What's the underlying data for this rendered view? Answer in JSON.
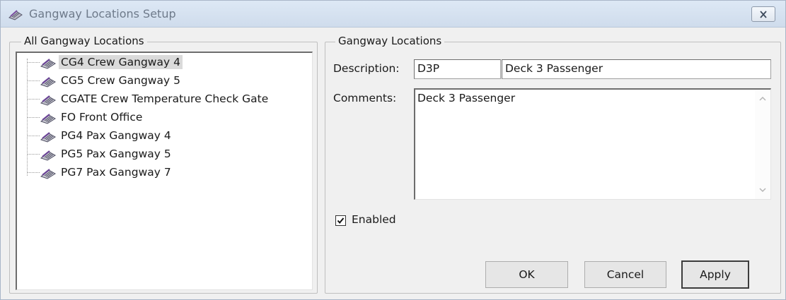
{
  "window": {
    "title": "Gangway Locations Setup",
    "icon": "gangway-icon"
  },
  "left_panel": {
    "group_label": "All Gangway Locations",
    "items": [
      {
        "code": "CG4",
        "name": "Crew Gangway 4",
        "label": "CG4  Crew Gangway 4",
        "selected": true
      },
      {
        "code": "CG5",
        "name": "Crew Gangway 5",
        "label": "CG5  Crew Gangway 5",
        "selected": false
      },
      {
        "code": "CGATE",
        "name": "Crew Temperature Check Gate",
        "label": "CGATE  Crew Temperature Check Gate",
        "selected": false
      },
      {
        "code": "FO",
        "name": "Front Office",
        "label": "FO  Front Office",
        "selected": false
      },
      {
        "code": "PG4",
        "name": "Pax Gangway 4",
        "label": "PG4  Pax Gangway 4",
        "selected": false
      },
      {
        "code": "PG5",
        "name": "Pax Gangway 5",
        "label": "PG5  Pax Gangway 5",
        "selected": false
      },
      {
        "code": "PG7",
        "name": "Pax Gangway 7",
        "label": "PG7  Pax Gangway 7",
        "selected": false
      }
    ]
  },
  "right_panel": {
    "group_label": "Gangway Locations",
    "description_label": "Description:",
    "description_code": "D3P",
    "description_text": "Deck 3 Passenger",
    "comments_label": "Comments:",
    "comments_value": "Deck 3 Passenger",
    "enabled_label": "Enabled",
    "enabled": true
  },
  "buttons": {
    "ok": "OK",
    "cancel": "Cancel",
    "apply": "Apply"
  }
}
